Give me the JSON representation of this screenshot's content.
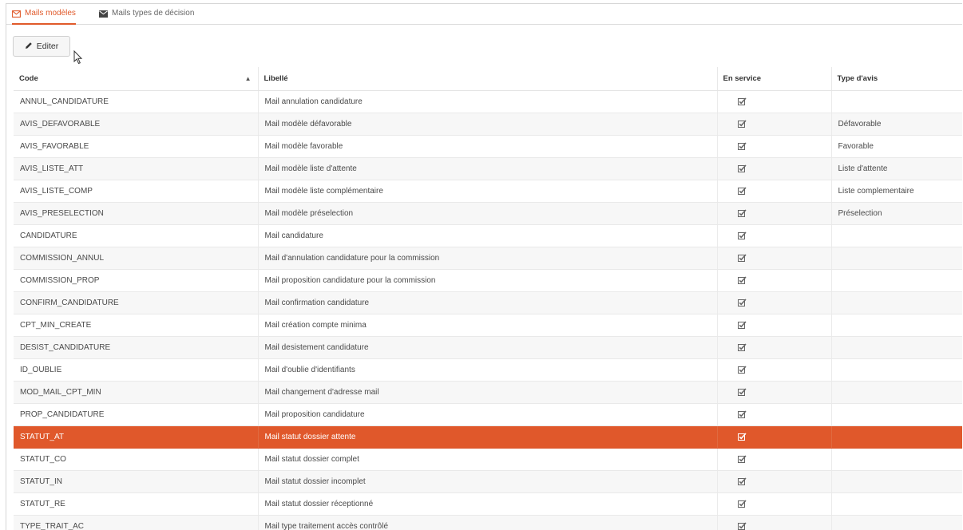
{
  "tabs": [
    {
      "label": "Mails modèles",
      "icon": "envelope-outline-icon",
      "active": true
    },
    {
      "label": "Mails types de décision",
      "icon": "envelope-icon",
      "active": false
    }
  ],
  "toolbar": {
    "edit_label": "Editer",
    "edit_icon": "pencil-icon"
  },
  "table": {
    "columns": [
      "Code",
      "Libellé",
      "En service",
      "Type d'avis"
    ],
    "sorted_column": "Code",
    "sort_direction": "ascending",
    "rows": [
      {
        "code": "ANNUL_CANDIDATURE",
        "libelle": "Mail annulation candidature",
        "en_service": true,
        "type_avis": ""
      },
      {
        "code": "AVIS_DEFAVORABLE",
        "libelle": "Mail modèle défavorable",
        "en_service": true,
        "type_avis": "Défavorable"
      },
      {
        "code": "AVIS_FAVORABLE",
        "libelle": "Mail modèle favorable",
        "en_service": true,
        "type_avis": "Favorable"
      },
      {
        "code": "AVIS_LISTE_ATT",
        "libelle": "Mail modèle liste d'attente",
        "en_service": true,
        "type_avis": "Liste d'attente"
      },
      {
        "code": "AVIS_LISTE_COMP",
        "libelle": "Mail modèle liste complémentaire",
        "en_service": true,
        "type_avis": "Liste complementaire"
      },
      {
        "code": "AVIS_PRESELECTION",
        "libelle": "Mail modèle préselection",
        "en_service": true,
        "type_avis": "Préselection"
      },
      {
        "code": "CANDIDATURE",
        "libelle": "Mail candidature",
        "en_service": true,
        "type_avis": ""
      },
      {
        "code": "COMMISSION_ANNUL",
        "libelle": "Mail d'annulation candidature pour la commission",
        "en_service": true,
        "type_avis": ""
      },
      {
        "code": "COMMISSION_PROP",
        "libelle": "Mail proposition candidature pour la commission",
        "en_service": true,
        "type_avis": ""
      },
      {
        "code": "CONFIRM_CANDIDATURE",
        "libelle": "Mail confirmation candidature",
        "en_service": true,
        "type_avis": ""
      },
      {
        "code": "CPT_MIN_CREATE",
        "libelle": "Mail création compte minima",
        "en_service": true,
        "type_avis": ""
      },
      {
        "code": "DESIST_CANDIDATURE",
        "libelle": "Mail desistement candidature",
        "en_service": true,
        "type_avis": ""
      },
      {
        "code": "ID_OUBLIE",
        "libelle": "Mail d'oublie d'identifiants",
        "en_service": true,
        "type_avis": ""
      },
      {
        "code": "MOD_MAIL_CPT_MIN",
        "libelle": "Mail changement d'adresse mail",
        "en_service": true,
        "type_avis": ""
      },
      {
        "code": "PROP_CANDIDATURE",
        "libelle": "Mail proposition candidature",
        "en_service": true,
        "type_avis": ""
      },
      {
        "code": "STATUT_AT",
        "libelle": "Mail statut dossier attente",
        "en_service": true,
        "type_avis": "",
        "selected": true
      },
      {
        "code": "STATUT_CO",
        "libelle": "Mail statut dossier complet",
        "en_service": true,
        "type_avis": ""
      },
      {
        "code": "STATUT_IN",
        "libelle": "Mail statut dossier incomplet",
        "en_service": true,
        "type_avis": ""
      },
      {
        "code": "STATUT_RE",
        "libelle": "Mail statut dossier réceptionné",
        "en_service": true,
        "type_avis": ""
      },
      {
        "code": "TYPE_TRAIT_AC",
        "libelle": "Mail type traitement accès contrôlé",
        "en_service": true,
        "type_avis": ""
      }
    ]
  },
  "colors": {
    "accent": "#e05a2b",
    "selected_row": "#e0582b",
    "stripe": "#f7f7f7"
  }
}
